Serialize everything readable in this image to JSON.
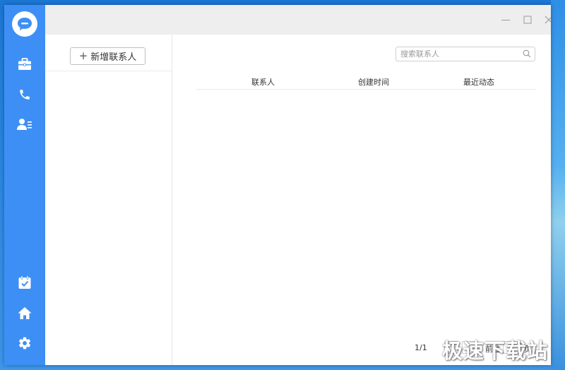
{
  "sidebar": {
    "logo_icon": "chat-bubble-icon",
    "top_items": [
      {
        "icon": "briefcase-icon"
      },
      {
        "icon": "phone-icon"
      },
      {
        "icon": "contacts-card-icon"
      }
    ],
    "bottom_items": [
      {
        "icon": "calendar-check-icon"
      },
      {
        "icon": "home-icon"
      },
      {
        "icon": "gear-icon"
      }
    ],
    "accent_color": "#3e8ff5"
  },
  "window_controls": [
    "minimize-icon",
    "maximize-icon",
    "close-icon"
  ],
  "left_panel": {
    "add_contact_label": "新增联系人"
  },
  "search": {
    "placeholder": "搜索联系人",
    "value": ""
  },
  "table": {
    "columns": [
      "联系人",
      "创建时间",
      "最近动态"
    ],
    "rows": []
  },
  "pagination": {
    "page_info": "1/1",
    "goto_label": "前往",
    "page_unit": "页"
  },
  "watermark": "极速下载站"
}
